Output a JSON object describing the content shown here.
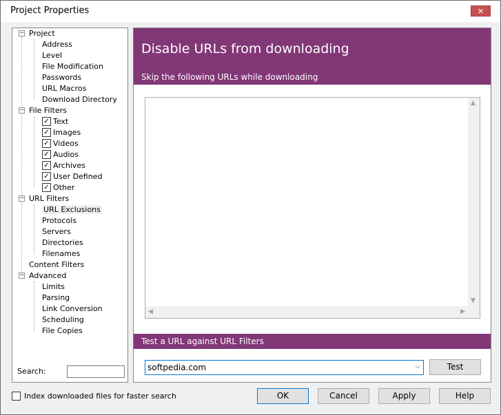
{
  "window": {
    "title": "Project Properties",
    "close_glyph": "✕"
  },
  "tree": {
    "groups": [
      {
        "label": "Project",
        "expander": "−",
        "items": [
          "Address",
          "Level",
          "File Modification",
          "Passwords",
          "URL Macros",
          "Download Directory"
        ]
      },
      {
        "label": "File Filters",
        "expander": "−",
        "items": [
          "Text",
          "Images",
          "Videos",
          "Audios",
          "Archives",
          "User Defined",
          "Other"
        ],
        "checked": true
      },
      {
        "label": "URL Filters",
        "expander": "−",
        "items": [
          "URL Exclusions",
          "Protocols",
          "Servers",
          "Directories",
          "Filenames"
        ]
      },
      {
        "label": "Content Filters"
      },
      {
        "label": "Advanced",
        "expander": "−",
        "items": [
          "Limits",
          "Parsing",
          "Link Conversion",
          "Scheduling",
          "File Copies"
        ]
      }
    ],
    "selected": "URL Exclusions",
    "check_glyph": "✓"
  },
  "search": {
    "label": "Search:",
    "value": ""
  },
  "content": {
    "title": "Disable URLs from downloading",
    "subtitle": "Skip the following URLs while downloading",
    "test_band_label": "Test a URL against URL Filters",
    "url_value": "softpedia.com",
    "test_button": "Test",
    "scroll_up": "▲",
    "scroll_down": "▼",
    "scroll_left": "◀",
    "scroll_right": "▶",
    "combo_glyph": "⌵"
  },
  "footer": {
    "index_label": "Index downloaded files for faster search",
    "ok": "OK",
    "cancel": "Cancel",
    "apply": "Apply",
    "help": "Help"
  },
  "colors": {
    "accent": "#823777",
    "selection_border": "#0078d7"
  }
}
